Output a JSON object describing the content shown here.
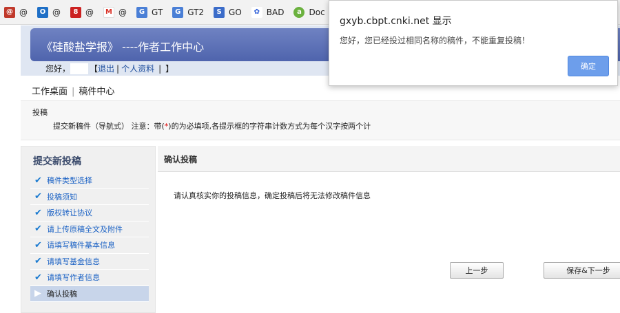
{
  "bookmarks": [
    {
      "label": "@",
      "icon": "mail-at-icon",
      "color": "#c0392b",
      "glyph": "@"
    },
    {
      "label": "@",
      "icon": "outlook-icon",
      "color": "#1e6fc6",
      "glyph": "O"
    },
    {
      "label": "@",
      "icon": "mail-163-icon",
      "color": "#cc2222",
      "glyph": "8"
    },
    {
      "label": "@",
      "icon": "gmail-icon",
      "color": "#d93025",
      "glyph": "M"
    },
    {
      "label": "GT",
      "icon": "translate-icon",
      "color": "#4a7fd6",
      "glyph": "G"
    },
    {
      "label": "GT2",
      "icon": "translate-icon",
      "color": "#4a7fd6",
      "glyph": "G"
    },
    {
      "label": "GO",
      "icon": "scholar-icon",
      "color": "#3b6cc9",
      "glyph": "S"
    },
    {
      "label": "BAD",
      "icon": "baidu-paw-icon",
      "color": "#2a5bd8",
      "glyph": "✿"
    },
    {
      "label": "Doc",
      "icon": "doc-icon",
      "color": "#6bb13f",
      "glyph": "a"
    }
  ],
  "header": {
    "title": "《硅酸盐学报》 ----作者工作中心",
    "greeting": "您好，",
    "logout": "退出",
    "profile": "个人资料",
    "bracket_open": "【",
    "bracket_close": "】",
    "divider": "|"
  },
  "breadcrumb": {
    "home": "工作桌面",
    "sep": "|",
    "current": "稿件中心"
  },
  "notice": {
    "title": "投稿",
    "text_before": "提交新稿件（导航式） 注意：带(",
    "required_mark": "*",
    "text_after": ")的为必填项,各提示框的字符串计数方式为每个汉字按两个计"
  },
  "sidebar": {
    "title": "提交新投稿",
    "steps": [
      {
        "label": "稿件类型选择",
        "done": true
      },
      {
        "label": "投稿须知",
        "done": true
      },
      {
        "label": "版权转让协议",
        "done": true
      },
      {
        "label": "请上传原稿全文及附件",
        "done": true
      },
      {
        "label": "请填写稿件基本信息",
        "done": true
      },
      {
        "label": "请填写基金信息",
        "done": true
      },
      {
        "label": "请填写作者信息",
        "done": true
      },
      {
        "label": "确认投稿",
        "done": false
      }
    ]
  },
  "main": {
    "title": "确认投稿",
    "confirm_text": "请认真核实你的投稿信息，确定投稿后将无法修改稿件信息",
    "prev_button": "上一步",
    "save_button": "保存&下一步"
  },
  "dialog": {
    "title": "gxyb.cbpt.cnki.net 显示",
    "message": "您好，您已经投过相同名称的稿件，不能重复投稿！",
    "ok_button": "确定"
  },
  "colors": {
    "accent": "#5063ad",
    "dialog_button": "#6d9eeb",
    "link": "#1a61c4"
  }
}
